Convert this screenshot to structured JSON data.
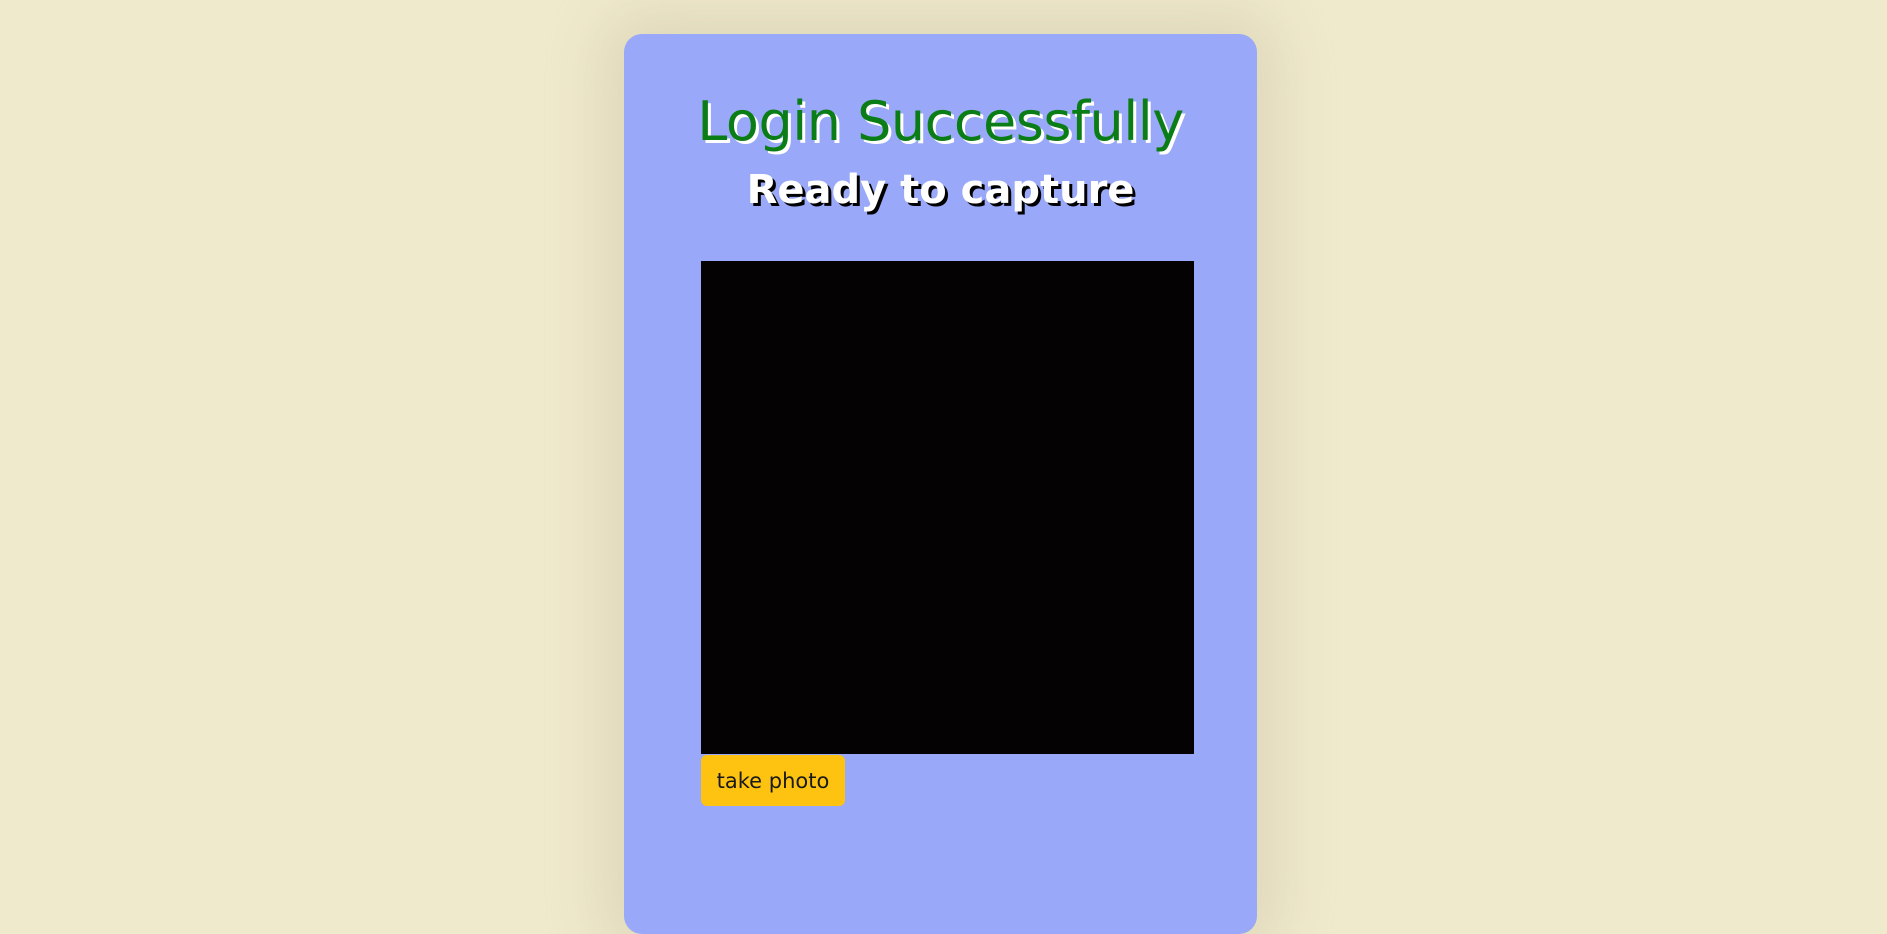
{
  "card": {
    "title": "Login Successfully",
    "subtitle": "Ready to capture",
    "capture_button_label": "take photo"
  },
  "colors": {
    "page_background": "#f0eacd",
    "card_background": "#99a8f8",
    "title_color": "#0b7d16",
    "button_color": "#fec210",
    "video_background": "#050203"
  }
}
